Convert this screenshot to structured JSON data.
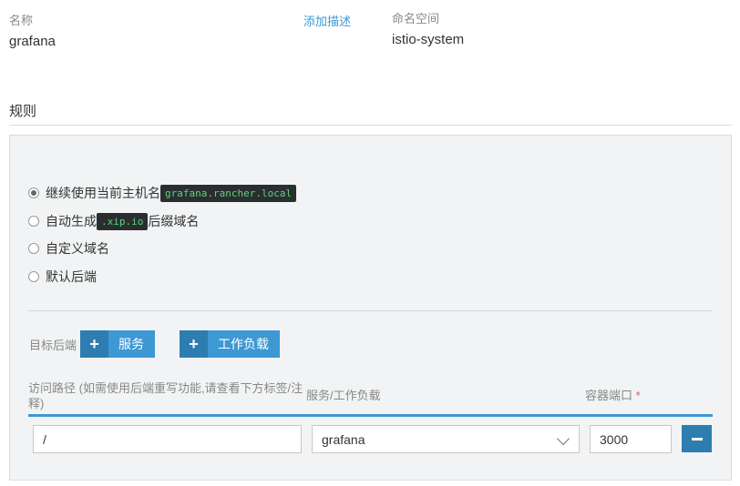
{
  "header": {
    "name_label": "名称",
    "name_value": "grafana",
    "add_description": "添加描述",
    "namespace_label": "命名空间",
    "namespace_value": "istio-system"
  },
  "rules": {
    "title": "规则",
    "radio_options": [
      {
        "text": "继续使用当前主机名",
        "code": "grafana.rancher.local",
        "suffix": "",
        "checked": true
      },
      {
        "text": "自动生成",
        "code": ".xip.io",
        "suffix": "后缀域名",
        "checked": false
      },
      {
        "text": "自定义域名",
        "code": "",
        "suffix": "",
        "checked": false
      },
      {
        "text": "默认后端",
        "code": "",
        "suffix": "",
        "checked": false
      }
    ],
    "target_backend_label": "目标后端",
    "add_service_label": "服务",
    "add_workload_label": "工作负载",
    "columns": {
      "path": "访问路径 (如需使用后端重写功能,请查看下方标签/注释)",
      "service": "服务/工作负载",
      "port": "容器端口",
      "port_required_mark": "*"
    },
    "row": {
      "path_value": "/",
      "service_value": "grafana",
      "port_value": "3000"
    }
  },
  "colors": {
    "accent": "#3d98d3",
    "accent_dark": "#2e7db0",
    "code_bg": "#2b2e31",
    "code_text": "#5ed27a"
  },
  "icons": {
    "plus": "plus-icon",
    "minus": "minus-icon",
    "chevron": "chevron-down-icon"
  }
}
